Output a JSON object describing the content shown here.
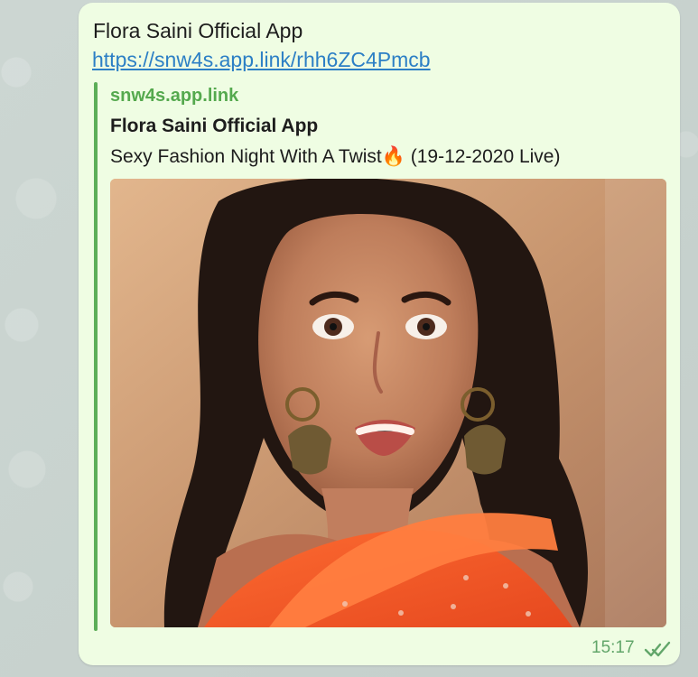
{
  "message": {
    "sender_text": "Flora Saini Official App",
    "link_text": "https://snw4s.app.link/rhh6ZC4Pmcb",
    "preview": {
      "site": "snw4s.app.link",
      "title": "Flora Saini Official App",
      "description": "Sexy Fashion Night With A Twist🔥 (19-12-2020 Live)"
    },
    "timestamp": "15:17",
    "status_icon": "double-check-icon"
  },
  "colors": {
    "bubble_bg": "#effde3",
    "link": "#2c7fc5",
    "preview_bar": "#5cae58",
    "site_text": "#55a94e",
    "time_text": "#62a66a"
  }
}
